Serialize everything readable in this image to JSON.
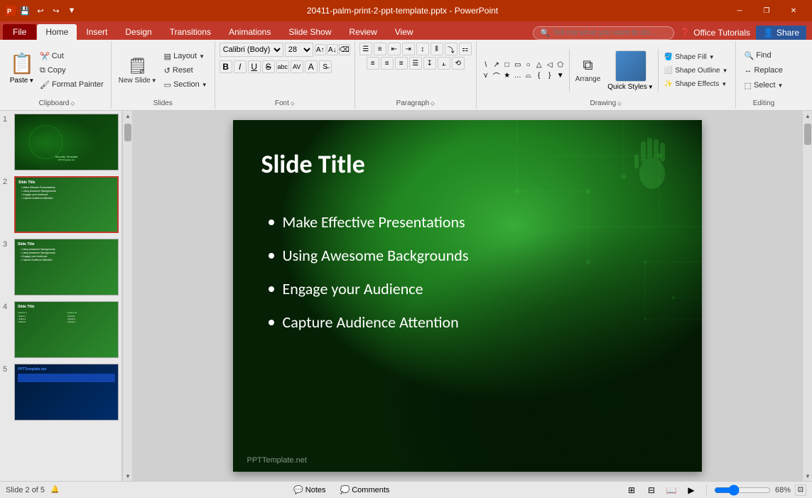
{
  "titleBar": {
    "filename": "20411-palm-print-2-ppt-template.pptx - PowerPoint",
    "quickAccessItems": [
      "save",
      "undo",
      "redo",
      "customize"
    ]
  },
  "ribbonTabs": {
    "active": "Home",
    "items": [
      "File",
      "Home",
      "Insert",
      "Design",
      "Transitions",
      "Animations",
      "Slide Show",
      "Review",
      "View"
    ]
  },
  "ribbon": {
    "clipboard": {
      "label": "Clipboard",
      "paste": "Paste",
      "cut": "Cut",
      "copy": "Copy",
      "formatPainter": "Format Painter"
    },
    "slides": {
      "label": "Slides",
      "newSlide": "New Slide",
      "layout": "Layout",
      "reset": "Reset",
      "section": "Section"
    },
    "font": {
      "label": "Font",
      "fontName": "Calibri (Body)",
      "fontSize": "28",
      "bold": "B",
      "italic": "I",
      "underline": "U",
      "strikethrough": "S",
      "shadow": "S",
      "fontColor": "A",
      "charSpacing": "AV"
    },
    "paragraph": {
      "label": "Paragraph",
      "bulletList": "≡",
      "numberedList": "≡",
      "decreaseIndent": "←",
      "increaseIndent": "→",
      "lineSpacing": "↕",
      "columns": "|||",
      "directionLTR": "→",
      "directionRTL": "←",
      "alignLeft": "≡",
      "alignCenter": "≡",
      "alignRight": "≡",
      "justify": "≡",
      "convertToSmArt": "SmArt"
    },
    "drawing": {
      "label": "Drawing",
      "arrange": "Arrange",
      "quickStyles": "Quick Styles",
      "shapeFill": "Shape Fill",
      "shapeOutline": "Shape Outline",
      "shapeEffects": "Shape Effects"
    },
    "editing": {
      "label": "Editing",
      "find": "Find",
      "replace": "Replace",
      "select": "Select"
    }
  },
  "slides": [
    {
      "num": 1,
      "type": "cover",
      "bgColor1": "#0a3a0a",
      "bgColor2": "#1a6a1a"
    },
    {
      "num": 2,
      "type": "content",
      "active": true,
      "bgColor1": "#1a5c1a",
      "bgColor2": "#2d8b2d"
    },
    {
      "num": 3,
      "type": "content",
      "bgColor1": "#1a5c1a",
      "bgColor2": "#2d8b2d"
    },
    {
      "num": 4,
      "type": "table",
      "bgColor1": "#1a5c1a",
      "bgColor2": "#2d8b2d"
    },
    {
      "num": 5,
      "type": "blue",
      "bgColor1": "#001a3a",
      "bgColor2": "#002d6b"
    }
  ],
  "mainSlide": {
    "title": "Slide Title",
    "bullets": [
      "Make Effective Presentations",
      "Using Awesome Backgrounds",
      "Engage your Audience",
      "Capture Audience Attention"
    ],
    "watermark": "PPTTemplate.net"
  },
  "statusBar": {
    "slideInfo": "Slide 2 of 5",
    "notesLabel": "Notes",
    "commentsLabel": "Comments",
    "zoom": "68%"
  },
  "topRight": {
    "officeTutorials": "Office Tutorials",
    "share": "Share"
  },
  "tellMe": {
    "placeholder": "Tell me what you want to do..."
  }
}
